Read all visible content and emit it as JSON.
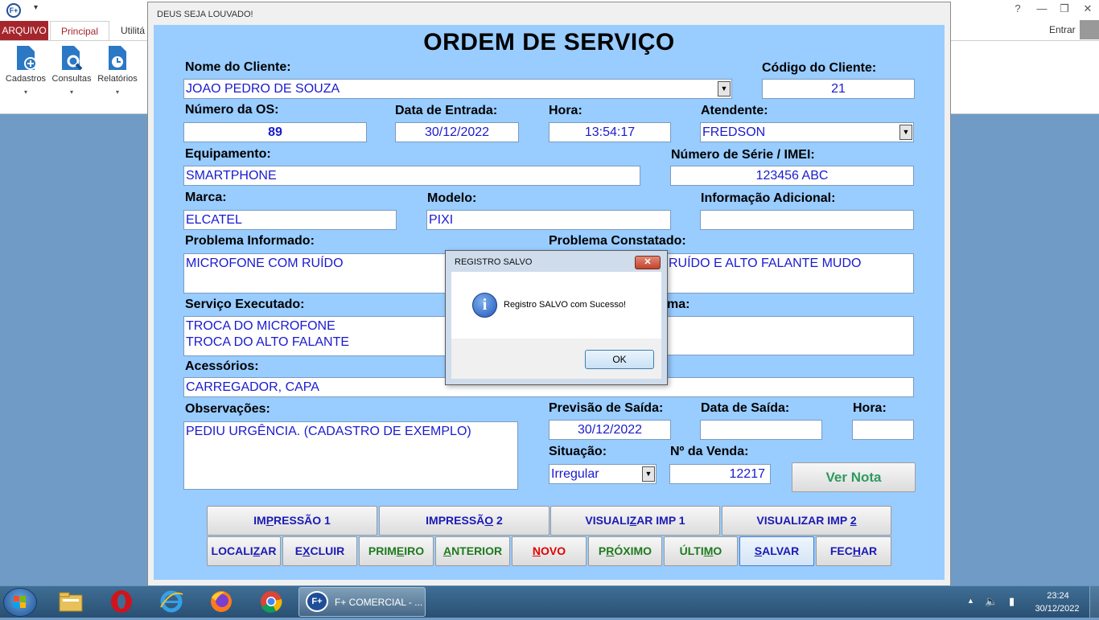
{
  "background_app": {
    "tabs": [
      "ARQUIVO",
      "Principal",
      "Utilitá"
    ],
    "ribbon_buttons": [
      "Cadastros",
      "Consultas",
      "Relatórios"
    ],
    "signin_label": "Entrar"
  },
  "main_window": {
    "title": "DEUS SEJA LOUVADO!",
    "heading": "ORDEM DE SERVIÇO"
  },
  "form": {
    "cliente_label": "Nome do Cliente:",
    "cliente_value": "JOAO PEDRO DE SOUZA",
    "codigo_label": "Código do Cliente:",
    "codigo_value": "21",
    "os_label": "Número da OS:",
    "os_value": "89",
    "data_entrada_label": "Data de Entrada:",
    "data_entrada_value": "30/12/2022",
    "hora_label": "Hora:",
    "hora_value": "13:54:17",
    "atendente_label": "Atendente:",
    "atendente_value": "FREDSON",
    "equipamento_label": "Equipamento:",
    "equipamento_value": "SMARTPHONE",
    "serie_label": "Número de Série / IMEI:",
    "serie_value": "123456 ABC",
    "marca_label": "Marca:",
    "marca_value": "ELCATEL",
    "modelo_label": "Modelo:",
    "modelo_value": "PIXI",
    "info_label": "Informação Adicional:",
    "info_value": "",
    "problema_inf_label": "Problema Informado:",
    "problema_inf_value": "MICROFONE COM RUÍDO",
    "problema_const_label": "Problema Constatado:",
    "problema_const_value": "RUÍDO E ALTO FALANTE MUDO",
    "servico_label": "Serviço Executado:",
    "servico_line1": "TROCA DO MICROFONE",
    "servico_line2": "TROCA DO ALTO FALANTE",
    "hidden_label_tail": "ma:",
    "acessorios_label": "Acessórios:",
    "acessorios_value": "CARREGADOR, CAPA",
    "obs_label": "Observações:",
    "obs_value": "PEDIU URGÊNCIA. (CADASTRO DE EXEMPLO)",
    "previsao_label": "Previsão de Saída:",
    "previsao_value": "30/12/2022",
    "data_saida_label": "Data de Saída:",
    "data_saida_value": "",
    "hora_saida_label": "Hora:",
    "hora_saida_value": "",
    "situacao_label": "Situação:",
    "situacao_value": "Irregular",
    "venda_label": "Nº da Venda:",
    "venda_value": "12217",
    "ver_nota_label": "Ver Nota"
  },
  "buttons_row1": [
    {
      "pre": "IM",
      "key": "P",
      "post": "RESSÃO 1"
    },
    {
      "pre": "IMPRESSÃ",
      "key": "O",
      "post": " 2"
    },
    {
      "pre": "VISUALI",
      "key": "Z",
      "post": "AR IMP 1"
    },
    {
      "pre": "VISUALIZAR IMP ",
      "key": "2",
      "post": ""
    }
  ],
  "buttons_row2": [
    {
      "pre": "LOCALI",
      "key": "Z",
      "post": "AR"
    },
    {
      "pre": "E",
      "key": "X",
      "post": "CLUIR"
    },
    {
      "pre": "PRIM",
      "key": "E",
      "post": "IRO"
    },
    {
      "pre": "",
      "key": "A",
      "post": "NTERIOR"
    },
    {
      "pre": "",
      "key": "N",
      "post": "OVO"
    },
    {
      "pre": "P",
      "key": "R",
      "post": "ÓXIMO"
    },
    {
      "pre": "ÚLTI",
      "key": "M",
      "post": "O"
    },
    {
      "pre": "",
      "key": "S",
      "post": "ALVAR"
    },
    {
      "pre": "FEC",
      "key": "H",
      "post": "AR"
    }
  ],
  "dialog": {
    "title": "REGISTRO SALVO",
    "message": "Registro SALVO com Sucesso!",
    "ok_label": "OK"
  },
  "taskbar": {
    "active_task": "F+ COMERCIAL - ...",
    "time": "23:24",
    "date": "30/12/2022"
  },
  "colors": {
    "form_background": "#99ccff",
    "field_text": "#1a1ad0",
    "button_text_blue": "#1a1ab5",
    "button_text_green": "#1d7a1d",
    "button_text_red": "#e00000",
    "desktop": "#6f9bc6"
  }
}
